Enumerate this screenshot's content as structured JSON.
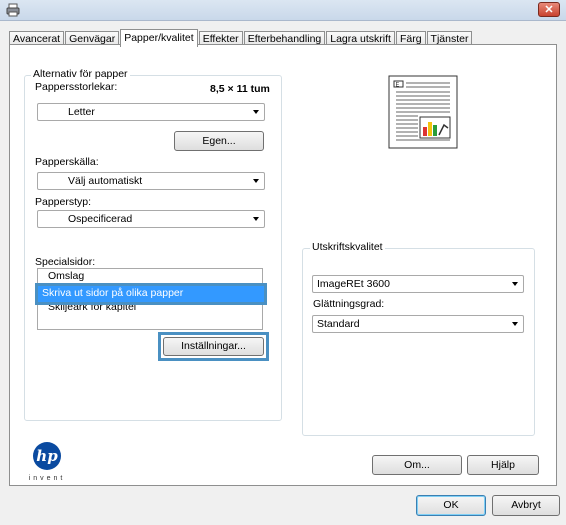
{
  "window": {
    "close_glyph": "✕"
  },
  "tabs": [
    {
      "label": "Avancerat"
    },
    {
      "label": "Genvägar"
    },
    {
      "label": "Papper/kvalitet",
      "active": true
    },
    {
      "label": "Effekter"
    },
    {
      "label": "Efterbehandling"
    },
    {
      "label": "Lagra utskrift"
    },
    {
      "label": "Färg"
    },
    {
      "label": "Tjänster"
    }
  ],
  "paper_options": {
    "legend": "Alternativ för papper",
    "size_label": "Pappersstorlekar:",
    "size_value": "8,5 × 11 tum",
    "size_select": "Letter",
    "custom_button": "Egen...",
    "source_label": "Papperskälla:",
    "source_select": "Välj automatiskt",
    "type_label": "Papperstyp:",
    "type_select": "Ospecificerad",
    "special_pages_label": "Specialsidor:",
    "special_pages": [
      {
        "label": "Omslag"
      },
      {
        "label": "Skriva ut sidor på olika papper",
        "selected": true
      },
      {
        "label": "Skiljeark för kapitel"
      }
    ],
    "settings_button": "Inställningar..."
  },
  "print_quality": {
    "legend": "Utskriftskvalitet",
    "quality_select": "ImageREt 3600",
    "smoothing_label": "Glättningsgrad:",
    "smoothing_select": "Standard"
  },
  "footer": {
    "about_button": "Om...",
    "help_button": "Hjälp",
    "ok_button": "OK",
    "cancel_button": "Avbryt",
    "logo_text": "hp",
    "logo_tagline": "invent"
  },
  "colors": {
    "accent_highlight": "#4a90c2",
    "selection": "#3399ff",
    "hp_blue": "#0a4aa0"
  }
}
